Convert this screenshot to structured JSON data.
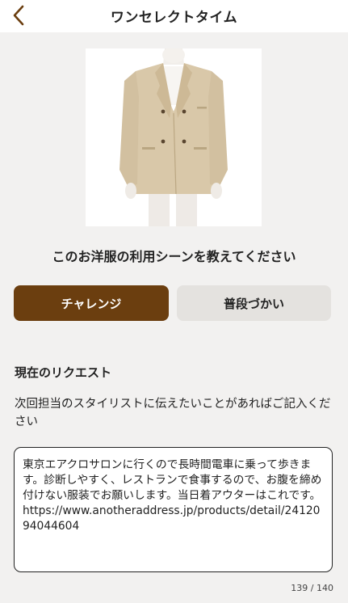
{
  "header": {
    "title": "ワンセレクトタイム",
    "back_icon": "chevron-left-icon",
    "accent_color": "#6b3e0f"
  },
  "product": {
    "image_description_icon": "jacket-image"
  },
  "question": {
    "text": "このお洋服の利用シーンを教えてください"
  },
  "choices": [
    {
      "label": "チャレンジ",
      "selected": true
    },
    {
      "label": "普段づかい",
      "selected": false
    }
  ],
  "request": {
    "label": "現在のリクエスト",
    "description": "次回担当のスタイリストに伝えたいことがあればご記入ください",
    "value": "東京エアクロサロンに行くので長時間電車に乗って歩きます。診断しやすく、レストランで食事するので、お腹を締め付けない服装でお願いします。当日着アウターはこれです。https://www.anotheraddress.jp/products/detail/2412094044604",
    "counter": "139 / 140"
  }
}
